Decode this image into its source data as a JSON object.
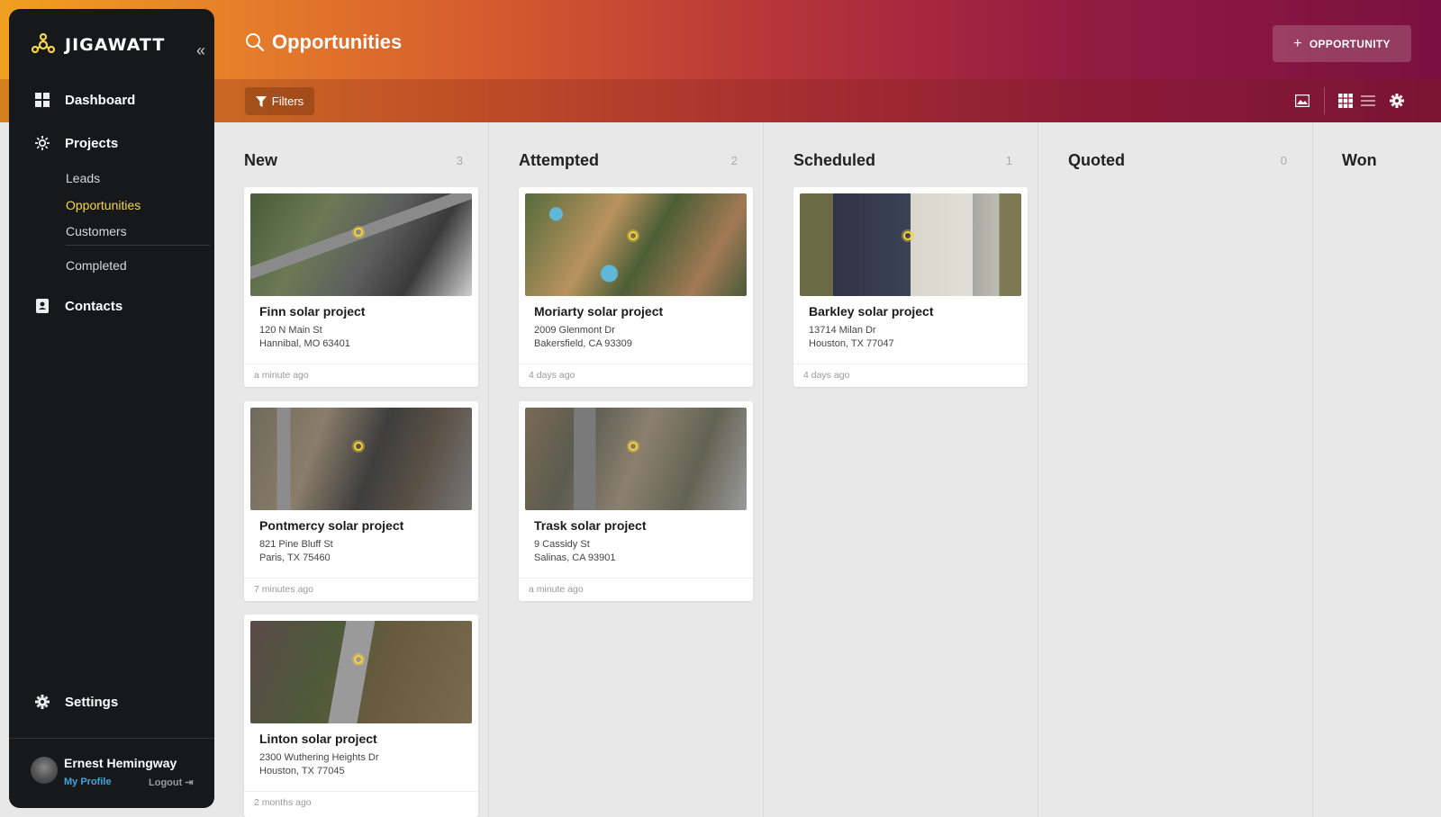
{
  "app": {
    "name": "JIGAWATT"
  },
  "sidebar": {
    "dashboard": "Dashboard",
    "projects": "Projects",
    "projects_sub": [
      "Leads",
      "Opportunities",
      "Customers",
      "Completed"
    ],
    "contacts": "Contacts",
    "settings": "Settings",
    "user": {
      "name": "Ernest Hemingway",
      "profile": "My Profile",
      "logout": "Logout"
    }
  },
  "header": {
    "title": "Opportunities",
    "add_button": "OPPORTUNITY",
    "filters": "Filters"
  },
  "board": {
    "columns": [
      {
        "title": "New",
        "count": "3"
      },
      {
        "title": "Attempted",
        "count": "2"
      },
      {
        "title": "Scheduled",
        "count": "1"
      },
      {
        "title": "Quoted",
        "count": "0"
      },
      {
        "title": "Won",
        "count": ""
      }
    ],
    "cards": [
      {
        "name": "Finn solar project",
        "addr1": "120 N Main St",
        "addr2": "Hannibal, MO 63401",
        "time": "a minute ago"
      },
      {
        "name": "Pontmercy solar project",
        "addr1": "821 Pine Bluff St",
        "addr2": "Paris, TX 75460",
        "time": "7 minutes ago"
      },
      {
        "name": "Linton solar project",
        "addr1": "2300 Wuthering Heights Dr",
        "addr2": "Houston, TX 77045",
        "time": "2 months ago"
      },
      {
        "name": "Moriarty solar project",
        "addr1": "2009 Glenmont Dr",
        "addr2": "Bakersfield, CA 93309",
        "time": "4 days ago"
      },
      {
        "name": "Trask solar project",
        "addr1": "9 Cassidy St",
        "addr2": "Salinas, CA 93901",
        "time": "a minute ago"
      },
      {
        "name": "Barkley solar project",
        "addr1": "13714 Milan Dr",
        "addr2": "Houston, TX 77047",
        "time": "4 days ago"
      }
    ]
  },
  "colors": {
    "accent": "#f3d54a",
    "link": "#3ea6e0",
    "sidebar": "#171819"
  }
}
